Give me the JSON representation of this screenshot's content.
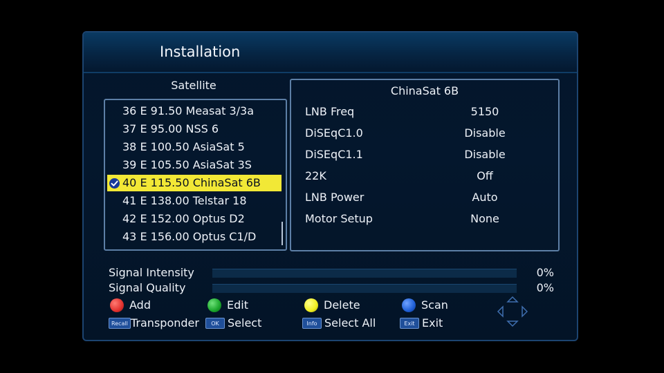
{
  "header": {
    "title": "Installation"
  },
  "satellite_list": {
    "heading": "Satellite",
    "items": [
      {
        "label": "36 E 91.50   Measat 3/3a",
        "selected": false
      },
      {
        "label": "37 E 95.00   NSS 6",
        "selected": false
      },
      {
        "label": "38 E 100.50 AsiaSat 5",
        "selected": false
      },
      {
        "label": "39 E 105.50 AsiaSat 3S",
        "selected": false
      },
      {
        "label": "40 E 115.50 ChinaSat 6B",
        "selected": true
      },
      {
        "label": "41 E 138.00 Telstar 18",
        "selected": false
      },
      {
        "label": "42 E 152.00 Optus D2",
        "selected": false
      },
      {
        "label": "43 E 156.00 Optus C1/D",
        "selected": false
      }
    ]
  },
  "details": {
    "title": "ChinaSat 6B",
    "params": [
      {
        "label": "LNB Freq",
        "value": "5150"
      },
      {
        "label": "DiSEqC1.0",
        "value": "Disable"
      },
      {
        "label": "DiSEqC1.1",
        "value": "Disable"
      },
      {
        "label": "22K",
        "value": "Off"
      },
      {
        "label": "LNB Power",
        "value": "Auto"
      },
      {
        "label": "Motor Setup",
        "value": "None"
      }
    ]
  },
  "signal": {
    "intensity_label": "Signal Intensity",
    "intensity_value": "0%",
    "intensity_level": 0,
    "quality_label": "Signal Quality",
    "quality_value": "0%",
    "quality_level": 0
  },
  "legend": {
    "add": "Add",
    "edit": "Edit",
    "delete": "Delete",
    "scan": "Scan",
    "transponder": "Transponder",
    "select": "Select",
    "select_all": "Select All",
    "exit": "Exit",
    "key_recall": "Recall",
    "key_ok": "OK",
    "key_info": "Info",
    "key_exit": "Exit"
  },
  "colors": {
    "red": "#e2322f",
    "green": "#1aa52b",
    "yellow": "#f0ee20",
    "blue": "#1f5fd6",
    "highlight": "#f2e836"
  },
  "icons": [
    "check-icon",
    "red-key-icon",
    "green-key-icon",
    "yellow-key-icon",
    "blue-key-icon",
    "nav-arrows-icon"
  ]
}
